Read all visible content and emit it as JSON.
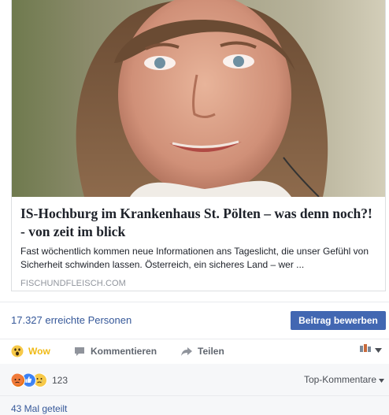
{
  "link_preview": {
    "title": "IS-Hochburg im Krankenhaus St. Pölten – was denn noch?! - von zeit im blick",
    "description": "Fast wöchentlich kommen neue Informationen ans Tageslicht, die unser Gefühl von Sicherheit schwinden lassen. Österreich, ein sicheres Land – wer ...",
    "domain": "FISCHUNDFLEISCH.COM",
    "image_icon": "portrait-photo"
  },
  "promotion": {
    "reach_text": "17.327 erreichte Personen",
    "boost_label": "Beitrag bewerben"
  },
  "actions": {
    "reaction_label": "Wow",
    "comment_label": "Kommentieren",
    "share_label": "Teilen"
  },
  "summary": {
    "reaction_icons": [
      "angry-icon",
      "like-icon",
      "sad-icon"
    ],
    "reaction_count": "123",
    "sort_label": "Top-Kommentare",
    "shares_text": "43 Mal geteilt"
  },
  "colors": {
    "link_blue": "#365899",
    "button_blue": "#4267b2",
    "wow_yellow": "#f0ba15",
    "grey_text": "#616770",
    "light_bg": "#f6f7f9"
  }
}
